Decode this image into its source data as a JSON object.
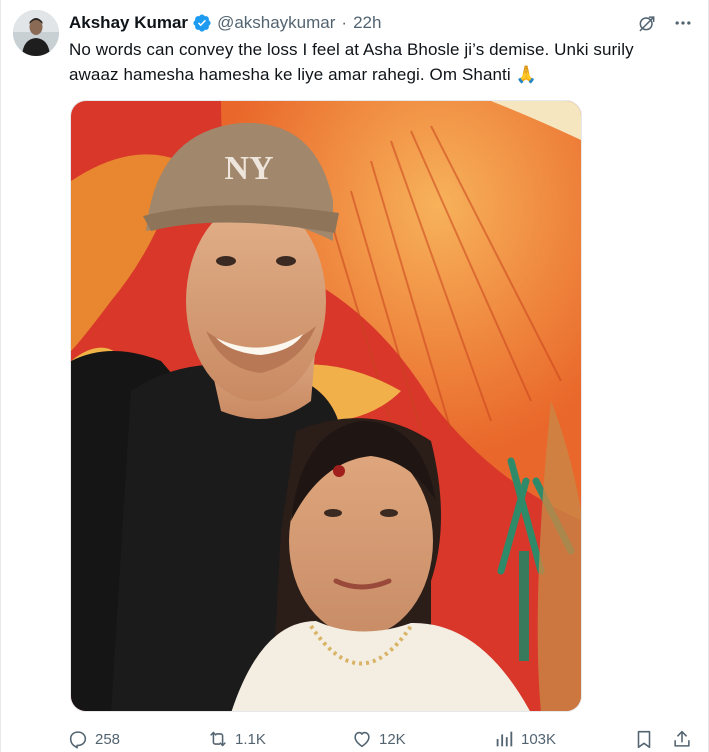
{
  "tweet": {
    "author_name": "Akshay Kumar",
    "handle": "@akshaykumar",
    "separator": "·",
    "time": "22h",
    "text": "No words can convey the loss I feel at Asha Bhosle ji’s demise. Unki surily awaaz hamesha hamesha ke liye amar rahegi. Om Shanti 🙏",
    "verified": true
  },
  "stats": {
    "replies": "258",
    "retweets": "1.1K",
    "likes": "12K",
    "views": "103K"
  },
  "icons": {
    "verified": "verified-badge-icon",
    "grok": "grok-icon",
    "more": "more-icon",
    "reply": "reply-icon",
    "retweet": "retweet-icon",
    "like": "heart-icon",
    "views": "views-icon",
    "bookmark": "bookmark-icon",
    "share": "share-icon"
  },
  "colors": {
    "text_primary": "#0f1419",
    "text_secondary": "#536471",
    "verified_blue": "#1d9bf0",
    "border": "#e6e9ec"
  }
}
